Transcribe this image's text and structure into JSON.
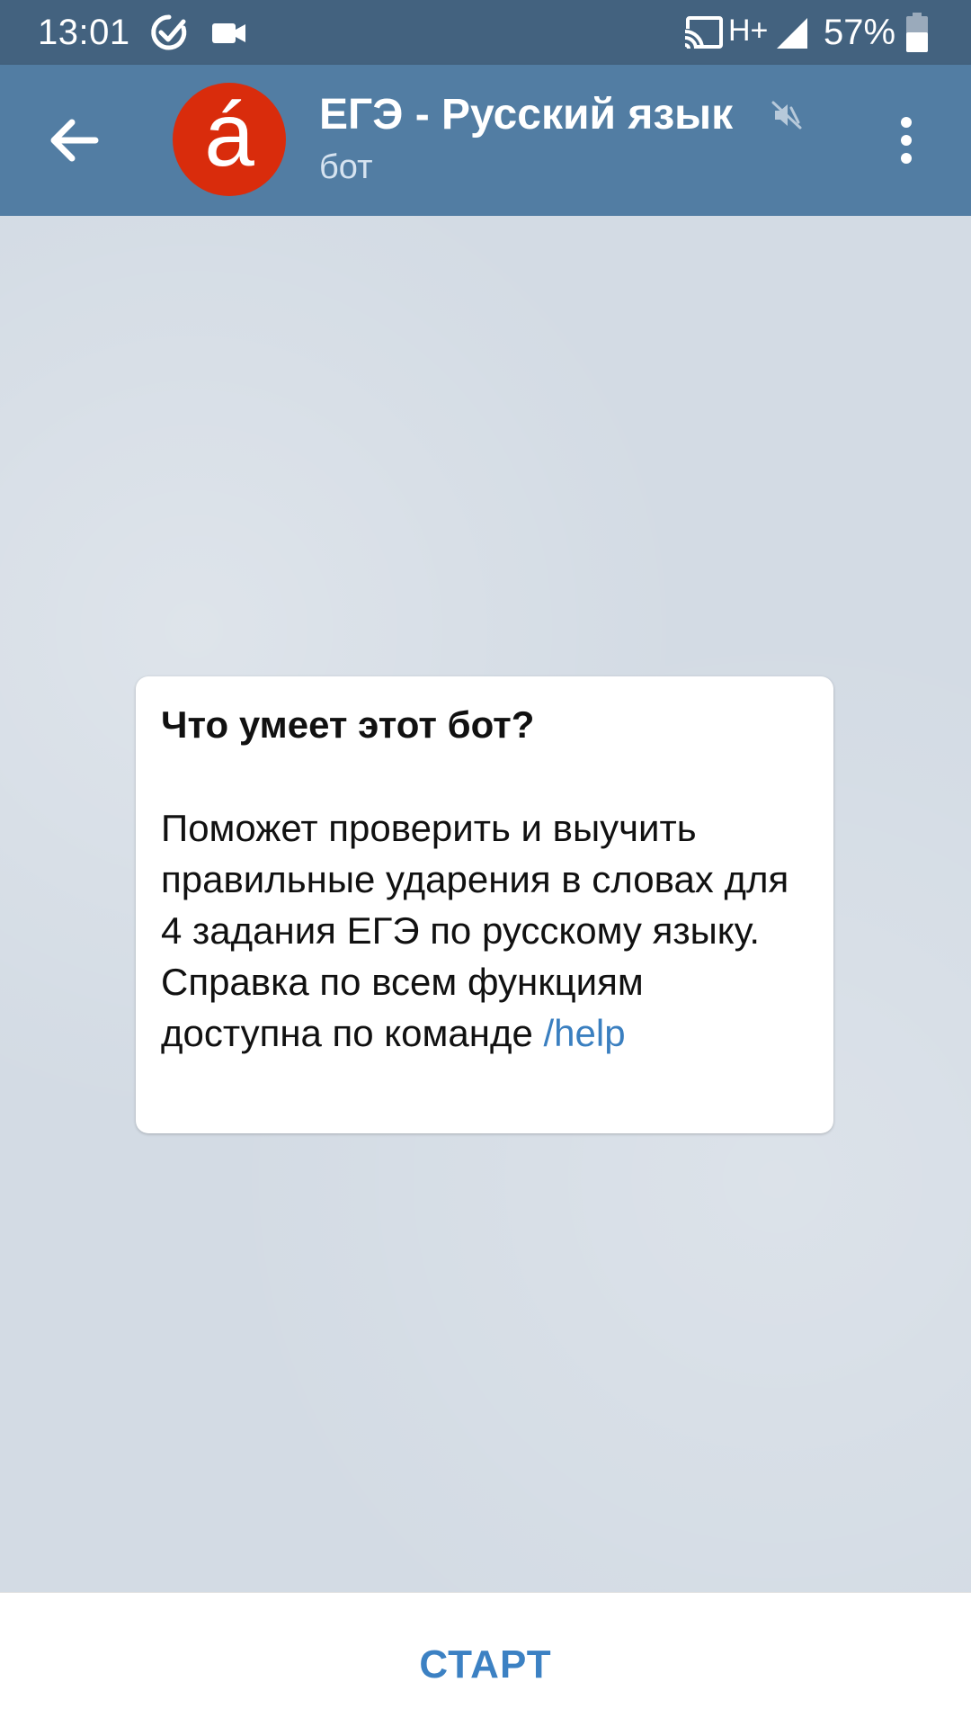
{
  "status_bar": {
    "time": "13:01",
    "network": "H+",
    "battery": "57%",
    "icons": [
      "check-circle-icon",
      "video-camera-icon",
      "cast-icon",
      "signal-icon",
      "battery-icon"
    ]
  },
  "header": {
    "avatar_letter": "á",
    "title": "ЕГЭ - Русский язык",
    "subtitle": "бот",
    "colors": {
      "status_bar": "#43627f",
      "header": "#527da3",
      "avatar": "#d92c0c"
    }
  },
  "bot_info": {
    "title": "Что умеет этот бот?",
    "description": "Поможет проверить и выучить правильные ударения в словах для 4 задания ЕГЭ по русскому языку. Справка по всем функциям доступна по команде ",
    "command": "/help"
  },
  "bottom": {
    "start_label": "СТАРТ",
    "accent_color": "#3c81c3"
  }
}
